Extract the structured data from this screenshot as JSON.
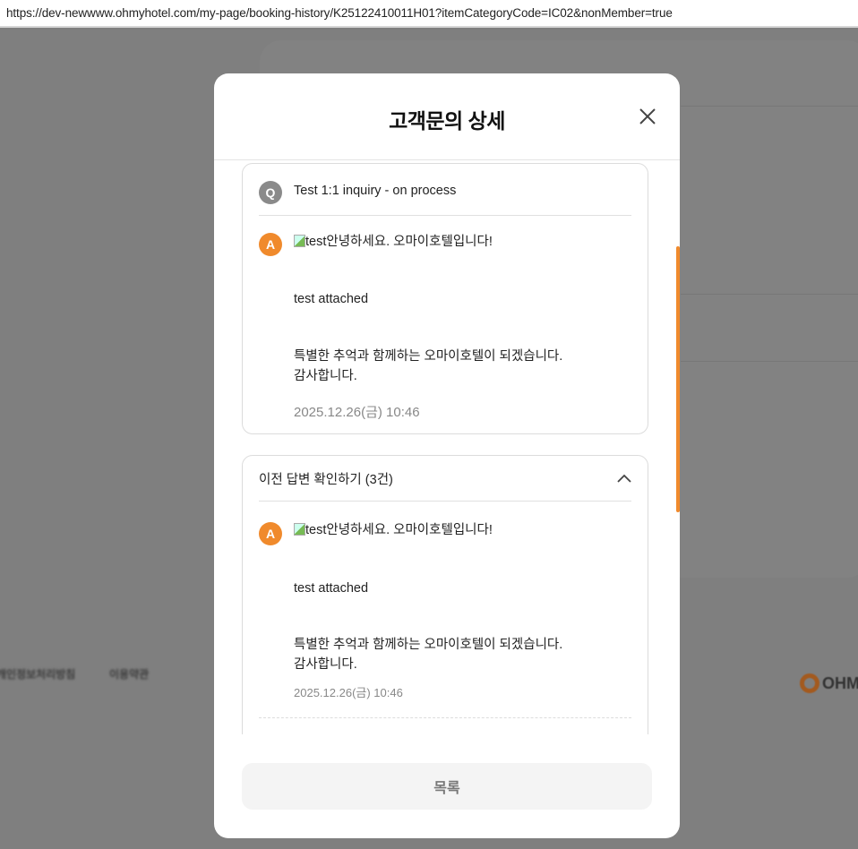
{
  "browser": {
    "url": "https://dev-newwww.ohmyhotel.com/my-page/booking-history/K25122410011H01?itemCategoryCode=IC02&nonMember=true"
  },
  "footer": {
    "links": [
      "개인정보처리방침",
      "이용약관"
    ],
    "logo": "OHM"
  },
  "modal": {
    "title": "고객문의 상세",
    "question": {
      "badge": "Q",
      "text": "Test 1:1 inquiry - on process"
    },
    "answer": {
      "badge": "A",
      "img_alt": "test",
      "greeting": "안녕하세요. 오마이호텔입니다!",
      "body": "test attached",
      "closing1": "특별한 추억과 함께하는 오마이호텔이 되겠습니다.",
      "closing2": "감사합니다.",
      "date": "2025.12.26(금) 10:46"
    },
    "previous": {
      "toggle_label": "이전 답변 확인하기 (3건)",
      "expanded": true,
      "items": [
        {
          "badge": "A",
          "img_alt": "test",
          "greeting": "안녕하세요. 오마이호텔입니다!",
          "body": "test attached",
          "closing1": "특별한 추억과 함께하는 오마이호텔이 되겠습니다.",
          "closing2": "감사합니다.",
          "date": "2025.12.26(금) 10:46"
        }
      ]
    },
    "list_button": "목록"
  },
  "colors": {
    "accent": "#f08a2c",
    "overlay": "#7f7f7f"
  }
}
